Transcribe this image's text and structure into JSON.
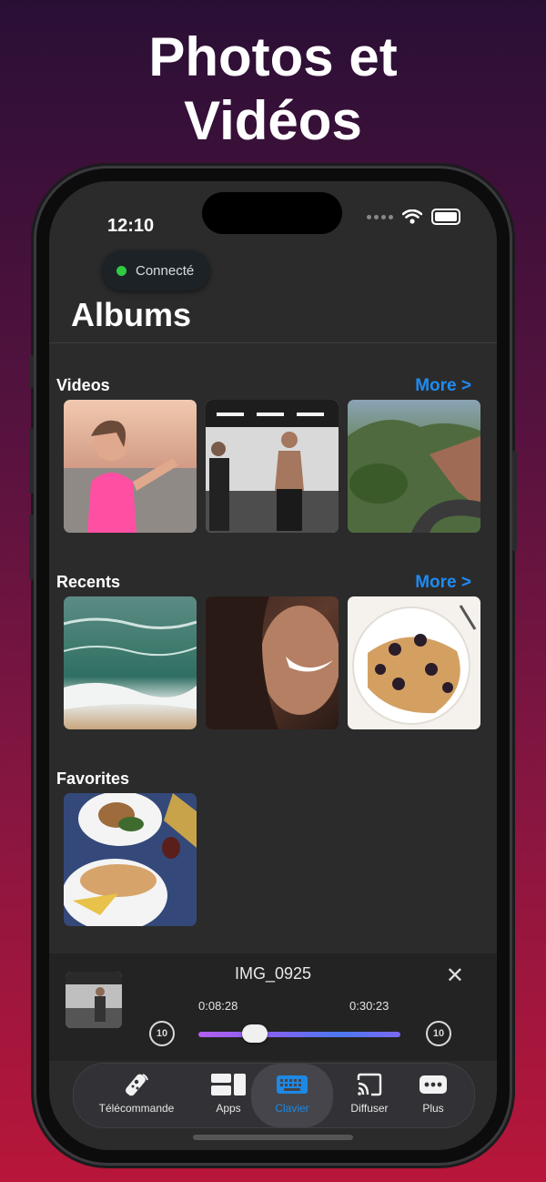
{
  "headline": {
    "line1": "Photos et",
    "line2": "Vidéos"
  },
  "status_bar": {
    "time": "12:10"
  },
  "connection": {
    "label": "Connecté",
    "color": "#2ecc40"
  },
  "page_title": "Albums",
  "sections": {
    "videos": {
      "title": "Videos",
      "more": "More >"
    },
    "recents": {
      "title": "Recents",
      "more": "More >"
    },
    "favorites": {
      "title": "Favorites"
    }
  },
  "player": {
    "title": "IMG_0925",
    "elapsed": "0:08:28",
    "total": "0:30:23",
    "progress": 0.28,
    "skip_back": "10",
    "skip_forward": "10"
  },
  "tabs": [
    {
      "label": "Télécommande",
      "icon": "remote-icon"
    },
    {
      "label": "Apps",
      "icon": "apps-icon"
    },
    {
      "label": "Clavier",
      "icon": "keyboard-icon",
      "active": true
    },
    {
      "label": "Diffuser",
      "icon": "cast-icon"
    },
    {
      "label": "Plus",
      "icon": "more-dots-icon"
    }
  ],
  "colors": {
    "accent": "#1f8bf2",
    "active_tab": "#1e88e5",
    "screen_bg": "#2b2b2b"
  }
}
